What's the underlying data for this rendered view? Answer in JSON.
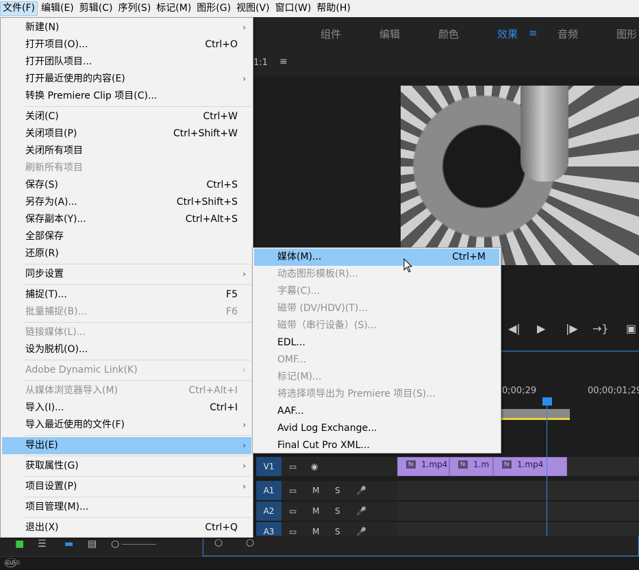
{
  "menubar": [
    "文件(F)",
    "编辑(E)",
    "剪辑(C)",
    "序列(S)",
    "标记(M)",
    "图形(G)",
    "视图(V)",
    "窗口(W)",
    "帮助(H)"
  ],
  "workspace_tabs": [
    "组件",
    "编辑",
    "颜色",
    "效果",
    "音频",
    "图形"
  ],
  "workspace_active": "效果",
  "monitor_label": "1:1",
  "file_menu": [
    {
      "label": "新建(N)",
      "shortcut": "",
      "submenu": true,
      "disabled": false
    },
    {
      "label": "打开项目(O)...",
      "shortcut": "Ctrl+O",
      "submenu": false,
      "disabled": false
    },
    {
      "label": "打开团队项目...",
      "shortcut": "",
      "submenu": false,
      "disabled": false
    },
    {
      "label": "打开最近使用的内容(E)",
      "shortcut": "",
      "submenu": true,
      "disabled": false
    },
    {
      "label": "转换 Premiere Clip 项目(C)...",
      "shortcut": "",
      "submenu": false,
      "disabled": false,
      "sep_after": true
    },
    {
      "label": "关闭(C)",
      "shortcut": "Ctrl+W",
      "submenu": false,
      "disabled": false
    },
    {
      "label": "关闭项目(P)",
      "shortcut": "Ctrl+Shift+W",
      "submenu": false,
      "disabled": false
    },
    {
      "label": "关闭所有项目",
      "shortcut": "",
      "submenu": false,
      "disabled": false
    },
    {
      "label": "刷新所有项目",
      "shortcut": "",
      "submenu": false,
      "disabled": true
    },
    {
      "label": "保存(S)",
      "shortcut": "Ctrl+S",
      "submenu": false,
      "disabled": false
    },
    {
      "label": "另存为(A)...",
      "shortcut": "Ctrl+Shift+S",
      "submenu": false,
      "disabled": false
    },
    {
      "label": "保存副本(Y)...",
      "shortcut": "Ctrl+Alt+S",
      "submenu": false,
      "disabled": false
    },
    {
      "label": "全部保存",
      "shortcut": "",
      "submenu": false,
      "disabled": false
    },
    {
      "label": "还原(R)",
      "shortcut": "",
      "submenu": false,
      "disabled": false,
      "sep_after": true
    },
    {
      "label": "同步设置",
      "shortcut": "",
      "submenu": true,
      "disabled": false,
      "sep_after": true
    },
    {
      "label": "捕捉(T)...",
      "shortcut": "F5",
      "submenu": false,
      "disabled": false
    },
    {
      "label": "批量捕捉(B)...",
      "shortcut": "F6",
      "submenu": false,
      "disabled": true,
      "sep_after": true
    },
    {
      "label": "链接媒体(L)...",
      "shortcut": "",
      "submenu": false,
      "disabled": true
    },
    {
      "label": "设为脱机(O)...",
      "shortcut": "",
      "submenu": false,
      "disabled": false,
      "sep_after": true
    },
    {
      "label": "Adobe Dynamic Link(K)",
      "shortcut": "",
      "submenu": true,
      "disabled": true,
      "sep_after": true
    },
    {
      "label": "从媒体浏览器导入(M)",
      "shortcut": "Ctrl+Alt+I",
      "submenu": false,
      "disabled": true
    },
    {
      "label": "导入(I)...",
      "shortcut": "Ctrl+I",
      "submenu": false,
      "disabled": false
    },
    {
      "label": "导入最近使用的文件(F)",
      "shortcut": "",
      "submenu": true,
      "disabled": false,
      "sep_after": true
    },
    {
      "label": "导出(E)",
      "shortcut": "",
      "submenu": true,
      "disabled": false,
      "highlight": true,
      "sep_after": true
    },
    {
      "label": "获取属性(G)",
      "shortcut": "",
      "submenu": true,
      "disabled": false,
      "sep_after": true
    },
    {
      "label": "项目设置(P)",
      "shortcut": "",
      "submenu": true,
      "disabled": false,
      "sep_after": true
    },
    {
      "label": "项目管理(M)...",
      "shortcut": "",
      "submenu": false,
      "disabled": false,
      "sep_after": true
    },
    {
      "label": "退出(X)",
      "shortcut": "Ctrl+Q",
      "submenu": false,
      "disabled": false
    }
  ],
  "export_menu": [
    {
      "label": "媒体(M)...",
      "shortcut": "Ctrl+M",
      "disabled": false,
      "highlight": true
    },
    {
      "label": "动态图形模板(R)...",
      "shortcut": "",
      "disabled": true
    },
    {
      "label": "字幕(C)...",
      "shortcut": "",
      "disabled": true
    },
    {
      "label": "磁带 (DV/HDV)(T)...",
      "shortcut": "",
      "disabled": true
    },
    {
      "label": "磁带（串行设备）(S)...",
      "shortcut": "",
      "disabled": true
    },
    {
      "label": "EDL...",
      "shortcut": "",
      "disabled": false
    },
    {
      "label": "OMF...",
      "shortcut": "",
      "disabled": true
    },
    {
      "label": "标记(M)...",
      "shortcut": "",
      "disabled": true
    },
    {
      "label": "将选择项导出为 Premiere 项目(S)...",
      "shortcut": "",
      "disabled": true
    },
    {
      "label": "AAF...",
      "shortcut": "",
      "disabled": false
    },
    {
      "label": "Avid Log Exchange...",
      "shortcut": "",
      "disabled": false
    },
    {
      "label": "Final Cut Pro XML...",
      "shortcut": "",
      "disabled": false
    }
  ],
  "timecodes": [
    "0;00;29",
    "00;00;01;29"
  ],
  "tracks": [
    {
      "name": "V1",
      "buttons": [
        "",
        ""
      ]
    },
    {
      "name": "A1",
      "buttons": [
        "",
        "M",
        "S",
        ""
      ]
    },
    {
      "name": "A2",
      "buttons": [
        "",
        "M",
        "S",
        ""
      ]
    },
    {
      "name": "A3",
      "buttons": [
        "",
        "M",
        "S",
        ""
      ]
    }
  ],
  "clips": [
    "1.mp4",
    "1.m",
    "1.mp4"
  ],
  "colors": {
    "accent": "#2d8ceb",
    "menu_highlight": "#91c9f7",
    "clip": "#a98ce0"
  }
}
